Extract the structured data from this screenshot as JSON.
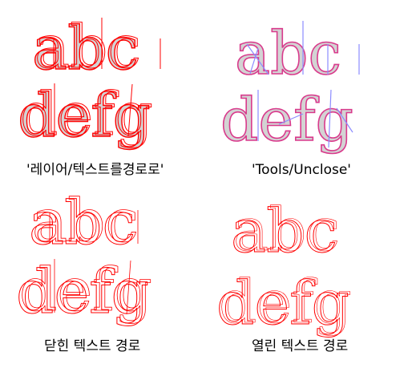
{
  "panels": [
    {
      "id": "layer-text-to-path",
      "letters_top": "abc",
      "letters_bottom": "defg",
      "caption": "'레이어/텍스트를경로로'"
    },
    {
      "id": "tools-unclose",
      "letters_top": "abc",
      "letters_bottom": "defg",
      "caption": "'Tools/Unclose'"
    },
    {
      "id": "closed-text-path",
      "letters_top": "abc",
      "letters_bottom": "defg",
      "caption": "닫힌 텍스트 경로"
    },
    {
      "id": "open-text-path",
      "letters_top": "abc",
      "letters_bottom": "defg",
      "caption": "열린 텍스트 경로"
    }
  ],
  "colors": {
    "outline": "#ff0000",
    "outline_alt": "#d93a8c",
    "guide": "#8c8cff",
    "fill": "#d3d3d3"
  }
}
